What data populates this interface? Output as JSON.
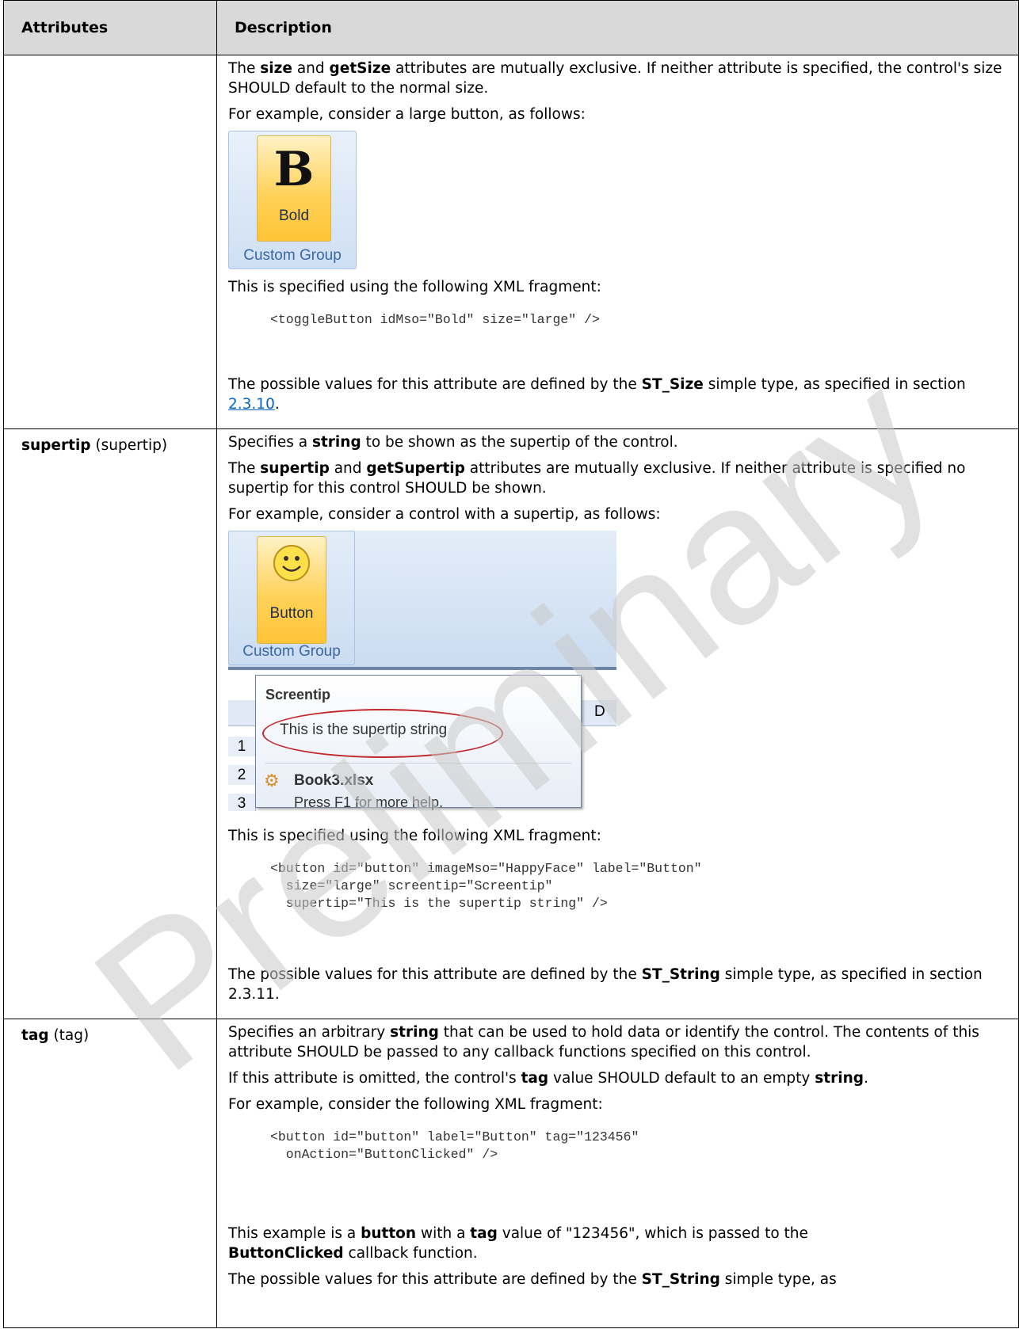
{
  "table": {
    "headers": {
      "attributes": "Attributes",
      "description": "Description"
    },
    "row_size": {
      "p1_a": "The ",
      "p1_b1": "size",
      "p1_c": " and ",
      "p1_b2": "getSize",
      "p1_d": " attributes are mutually exclusive. If neither attribute is specified, the control's size SHOULD default to the normal size.",
      "p2": "For example, consider a large button, as follows:",
      "image": {
        "glyph": "B",
        "button_label": "Bold",
        "group_label": "Custom Group"
      },
      "p3": "This is specified using the following XML fragment:",
      "code": "<toggleButton idMso=\"Bold\" size=\"large\" />",
      "p4_a": "The possible values for this attribute are defined by the ",
      "p4_b": "ST_Size",
      "p4_c": " simple type, as specified in section ",
      "p4_link": "2.3.10",
      "p4_d": "."
    },
    "row_supertip": {
      "name": "supertip",
      "name_suffix": " (supertip)",
      "p1_a": "Specifies a ",
      "p1_b": "string",
      "p1_c": " to be shown as the supertip of the control.",
      "p2_a": "The ",
      "p2_b1": "supertip",
      "p2_c": " and ",
      "p2_b2": "getSupertip",
      "p2_d": " attributes are mutually exclusive. If neither attribute is specified no supertip for this control SHOULD be shown.",
      "p3": "For example, consider a control with a supertip, as follows:",
      "image": {
        "button_label": "Button",
        "group_label": "Custom Group",
        "tooltip_title": "Screentip",
        "tooltip_text": "This is the supertip string",
        "file_name": "Book3.xlsx",
        "help_text": "Press F1 for more help.",
        "rows": [
          "1",
          "2",
          "3"
        ],
        "column": "D"
      },
      "p4": "This is specified using the following XML fragment:",
      "code": "<button id=\"button\" imageMso=\"HappyFace\" label=\"Button\"\n  size=\"large\" screentip=\"Screentip\"\n  supertip=\"This is the supertip string\" />",
      "p5_a": "The possible values for this attribute are defined by the ",
      "p5_b": "ST_String",
      "p5_c": " simple type, as specified in section 2.3.11."
    },
    "row_tag": {
      "name": "tag",
      "name_suffix": " (tag)",
      "p1_a": "Specifies an arbitrary ",
      "p1_b": "string",
      "p1_c": " that can be used to hold data or identify the control. The contents of this attribute SHOULD be passed to any callback functions specified on this control.",
      "p2_a": "If this attribute is omitted, the control's ",
      "p2_b1": "tag",
      "p2_c": " value SHOULD default to an empty ",
      "p2_b2": "string",
      "p2_d": ".",
      "p3": "For example, consider the following XML fragment:",
      "code": "<button id=\"button\" label=\"Button\" tag=\"123456\"\n  onAction=\"ButtonClicked\" />",
      "p4_a": "This example is a ",
      "p4_b1": "button",
      "p4_c": " with a ",
      "p4_b2": "tag",
      "p4_d": " value of \"123456\", which is passed to the ",
      "p4_b3": "ButtonClicked",
      "p4_e": " callback function.",
      "p5_a": "The possible values for this attribute are defined by the ",
      "p5_b": "ST_String",
      "p5_c": " simple type, as"
    }
  },
  "watermark": {
    "text": "Preliminary",
    "color": "#c8c8c8"
  }
}
